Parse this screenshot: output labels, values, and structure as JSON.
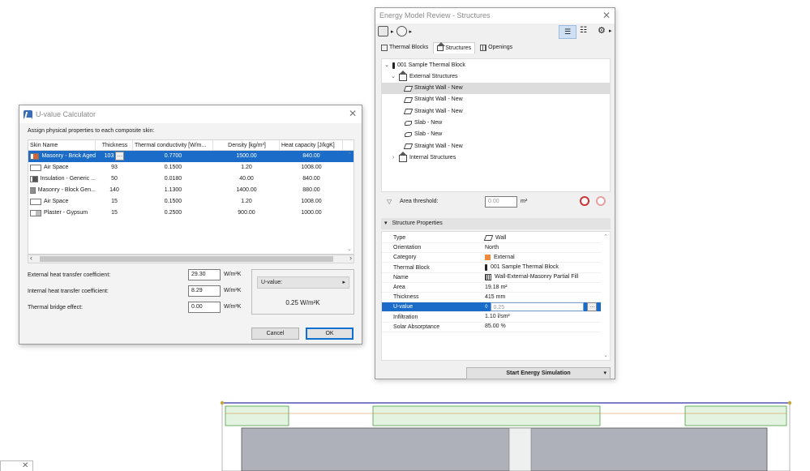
{
  "uvalue_calculator": {
    "title": "U-value Calculator",
    "instruction": "Assign physical properties to each composite skin:",
    "columns": [
      "Skin Name",
      "Thickness",
      "Thermal conductivity [W/m...",
      "Density [kg/m³]",
      "Heat capacity [J/kgK]"
    ],
    "rows": [
      {
        "name": "Masonry - Brick Aged",
        "thickness": "103",
        "conductivity": "0.7700",
        "density": "1500.00",
        "heat": "840.00",
        "swatch": "#d3643a",
        "selected": true
      },
      {
        "name": "Air Space",
        "thickness": "93",
        "conductivity": "0.1500",
        "density": "1.20",
        "heat": "1008.00",
        "swatch": "#ffffff"
      },
      {
        "name": "Insulation - Generic ...",
        "thickness": "50",
        "conductivity": "0.0180",
        "density": "40.00",
        "heat": "840.00",
        "swatch": "#555555"
      },
      {
        "name": "Masonry - Block Gen...",
        "thickness": "140",
        "conductivity": "1.1300",
        "density": "1400.00",
        "heat": "880.00",
        "swatch": "#8e8e8e"
      },
      {
        "name": "Air Space",
        "thickness": "15",
        "conductivity": "0.1500",
        "density": "1.20",
        "heat": "1008.00",
        "swatch": "#ffffff"
      },
      {
        "name": "Plaster - Gypsum",
        "thickness": "15",
        "conductivity": "0.2500",
        "density": "900.00",
        "heat": "1000.00",
        "swatch": "#bdbdbd"
      }
    ],
    "ext_label": "External heat transfer coefficient:",
    "ext_value": "29.30",
    "int_label": "Internal heat transfer coefficient:",
    "int_value": "8.29",
    "bridge_label": "Thermal bridge effect:",
    "bridge_value": "0.00",
    "unit": "W/m²K",
    "uvalue_dropdown": "U-value:",
    "uvalue_result": "0.25  W/m²K",
    "cancel": "Cancel",
    "ok": "OK"
  },
  "energy_review": {
    "title": "Energy Model Review - Structures",
    "tabs": [
      "Thermal Blocks",
      "Structures",
      "Openings"
    ],
    "tree": {
      "root": "001 Sample Thermal Block",
      "external": "External Structures",
      "items": [
        "Straight Wall - New",
        "Straight Wall - New",
        "Straight Wall - New",
        "Slab - New",
        "Slab - New",
        "Straight Wall - New"
      ],
      "internal": "Internal Structures"
    },
    "area_label": "Area threshold:",
    "area_value": "0.00",
    "area_unit": "m²",
    "props_header": "Structure Properties",
    "props": [
      {
        "label": "Type",
        "value": "Wall",
        "icon": "wall-icon"
      },
      {
        "label": "Orientation",
        "value": "North"
      },
      {
        "label": "Category",
        "value": "External",
        "icon": "category-swatch"
      },
      {
        "label": "Thermal Block",
        "value": "001 Sample Thermal Block",
        "icon": "thermal-block-icon"
      },
      {
        "label": "Name",
        "value": "Wall-External-Masonry Partial Fill",
        "icon": "composite-icon"
      },
      {
        "label": "Area",
        "value": "19.18 m²"
      },
      {
        "label": "Thickness",
        "value": "415 mm"
      },
      {
        "label": "U-value",
        "value": "0.25",
        "selected": true
      },
      {
        "label": "Infiltration",
        "value": "1.10 l/sm²"
      },
      {
        "label": "Solar Absorptance",
        "value": "85.00 %"
      }
    ],
    "start_button": "Start Energy Simulation",
    "category_color": "#f08a3c"
  }
}
